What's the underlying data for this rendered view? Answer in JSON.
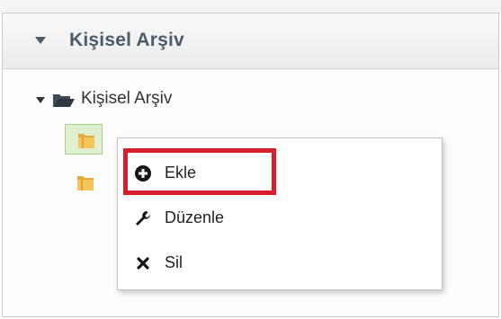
{
  "panel": {
    "title": "Kişisel Arşiv",
    "toggle_icon": "triangle-down-icon"
  },
  "tree": {
    "root_label": "Kişisel Arşiv",
    "root_icon": "folder-open-icon",
    "children_icons": [
      "folder-icon",
      "folder-icon"
    ]
  },
  "context_menu": {
    "items": [
      {
        "label": "Ekle",
        "icon": "plus-circle-icon"
      },
      {
        "label": "Düzenle",
        "icon": "wrench-icon"
      },
      {
        "label": "Sil",
        "icon": "close-icon"
      }
    ]
  },
  "colors": {
    "highlight_border": "#d61f2a",
    "selected_node_bg": "#dff0d0",
    "header_title": "#4a5c6a"
  }
}
